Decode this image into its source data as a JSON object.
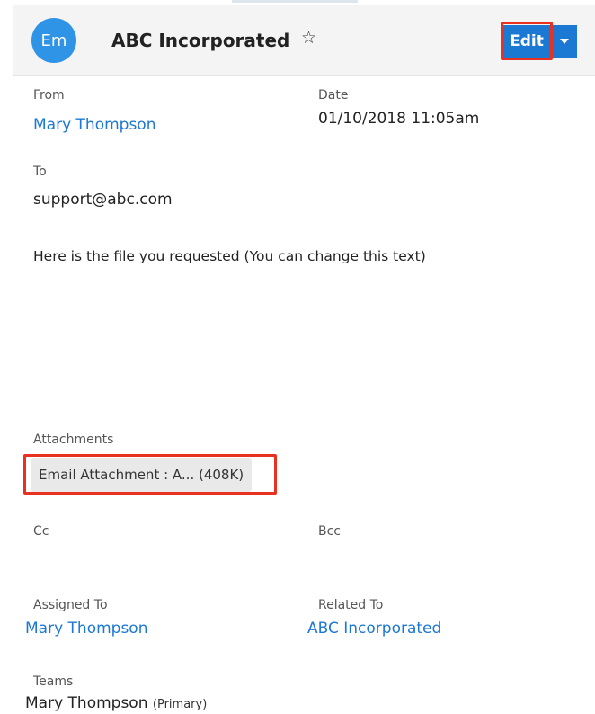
{
  "header": {
    "avatar_initials": "Em",
    "title": "ABC Incorporated",
    "favorite_icon": "star-outline-icon",
    "edit_label": "Edit",
    "dropdown_icon": "caret-down-icon"
  },
  "fields": {
    "from": {
      "label": "From",
      "value": "Mary Thompson"
    },
    "date": {
      "label": "Date",
      "value": "01/10/2018 11:05am"
    },
    "to": {
      "label": "To",
      "value": "support@abc.com"
    },
    "body": "Here is the file you requested (You can change this text)",
    "attachments": {
      "label": "Attachments",
      "items": [
        {
          "name": "Email Attachment : A... (408K)"
        }
      ]
    },
    "cc": {
      "label": "Cc",
      "value": ""
    },
    "bcc": {
      "label": "Bcc",
      "value": ""
    },
    "assigned_to": {
      "label": "Assigned To",
      "value": "Mary Thompson"
    },
    "related_to": {
      "label": "Related To",
      "value": "ABC Incorporated"
    },
    "teams": {
      "label": "Teams",
      "value": "Mary Thompson",
      "suffix": "(Primary)"
    }
  },
  "colors": {
    "accent": "#1b78d3",
    "avatar": "#2f93e6",
    "highlight": "#e8311f",
    "header_bg": "#f4f4f4"
  }
}
